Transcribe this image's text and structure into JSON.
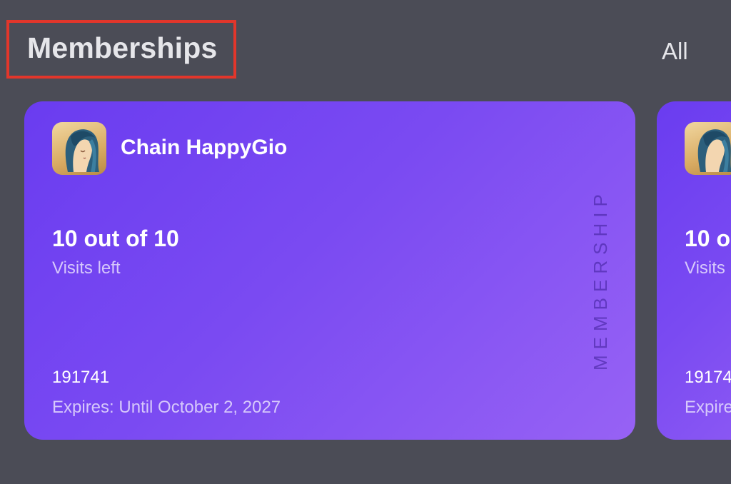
{
  "header": {
    "title": "Memberships",
    "all_link": "All"
  },
  "colors": {
    "background": "#4b4c56",
    "card_gradient_start": "#6a3cf0",
    "card_gradient_end": "#9762f4",
    "highlight_box": "#e2362b"
  },
  "cards": [
    {
      "name": "Chain HappyGio",
      "visits_count": "10 out of 10",
      "visits_label": "Visits left",
      "number": "191741",
      "expires": "Expires: Until October 2, 2027",
      "vertical_label": "MEMBERSHIP",
      "logo_icon": "woman-profile-logo"
    },
    {
      "name": "",
      "visits_count": "10 o",
      "visits_label": "Visits",
      "number": "19174",
      "expires": "Expire",
      "logo_icon": "woman-profile-logo"
    }
  ]
}
